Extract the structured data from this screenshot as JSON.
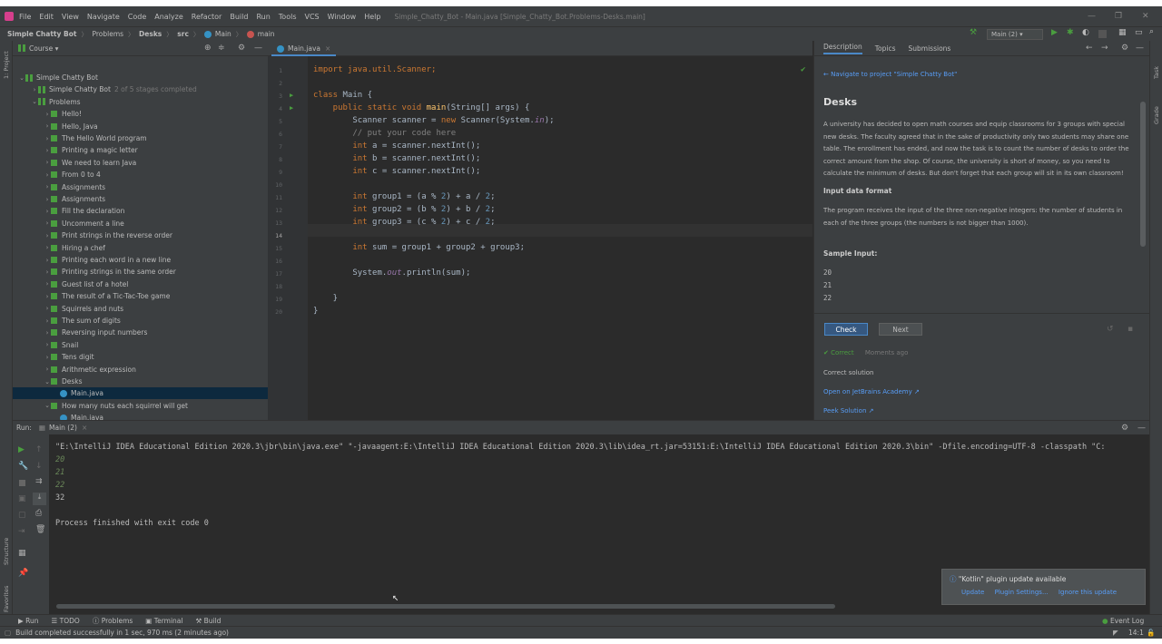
{
  "menubar": {
    "items": [
      "File",
      "Edit",
      "View",
      "Navigate",
      "Code",
      "Analyze",
      "Refactor",
      "Build",
      "Run",
      "Tools",
      "VCS",
      "Window",
      "Help"
    ],
    "window_title": "Simple_Chatty_Bot - Main.java [Simple_Chatty_Bot.Problems-Desks.main]"
  },
  "navbar": {
    "crumbs": [
      "Simple Chatty Bot",
      "Problems",
      "Desks",
      "src",
      "Main",
      "main"
    ],
    "run_config": "Main (2) ▾"
  },
  "project": {
    "header": "Course ▾",
    "side_label": "1: Project",
    "root": "Simple Chatty Bot",
    "stage_item": "Simple Chatty Bot",
    "stage_note": "2 of 5 stages completed",
    "problems_label": "Problems",
    "problems": [
      "Hello!",
      "Hello, Java",
      "The Hello World program",
      "Printing a magic letter",
      "We need to learn Java",
      "From 0 to 4",
      "Assignments",
      "Assignments",
      "Fill the declaration",
      "Uncomment a line",
      "Print strings in the reverse order",
      "Hiring a chef",
      "Printing each word in a new line",
      "Printing strings in the same order",
      "Guest list of a hotel",
      "The result of a Tic-Tac-Toe game",
      "Squirrels and nuts",
      "The sum of digits",
      "Reversing input numbers",
      "Snail",
      "Tens digit",
      "Arithmetic expression"
    ],
    "desks": "Desks",
    "desks_file": "Main.java",
    "nuts": "How many nuts each squirrel will get",
    "nuts_file": "Main.java"
  },
  "editor": {
    "tab": "Main.java",
    "line_numbers": [
      "1",
      "2",
      "3",
      "4",
      "5",
      "6",
      "7",
      "8",
      "9",
      "10",
      "11",
      "12",
      "13",
      "14",
      "15",
      "16",
      "17",
      "18",
      "19",
      "20"
    ],
    "lines": {
      "l1": "import java.util.Scanner;",
      "l3a": "class",
      "l3b": " Main {",
      "l4a": "    public static void ",
      "l4b": "main",
      "l4c": "(String[] args) {",
      "l5a": "        Scanner scanner = ",
      "l5b": "new",
      "l5c": " Scanner(System.",
      "l5d": "in",
      "l5e": ");",
      "l6": "        // put your code here",
      "l7a": "        int",
      "l7b": " a = scanner.nextInt();",
      "l8a": "        int",
      "l8b": " b = scanner.nextInt();",
      "l9a": "        int",
      "l9b": " c = scanner.nextInt();",
      "l11a": "        int",
      "l11b": " group1 = (a % ",
      "l11c": "2",
      "l11d": ") + a / ",
      "l11e": "2",
      "l11f": ";",
      "l12a": "        int",
      "l12b": " group2 = (b % ",
      "l12c": "2",
      "l12d": ") + b / ",
      "l12e": "2",
      "l12f": ";",
      "l13a": "        int",
      "l13b": " group3 = (c % ",
      "l13c": "2",
      "l13d": ") + c / ",
      "l13e": "2",
      "l13f": ";",
      "l15a": "        int",
      "l15b": " sum = group1 + group2 + group3;",
      "l17a": "        System.",
      "l17b": "out",
      "l17c": ".println(sum);",
      "l19": "    }",
      "l20": "}"
    }
  },
  "description": {
    "tabs": [
      "Description",
      "Topics",
      "Submissions"
    ],
    "nav_link": "Navigate to project \"Simple Chatty Bot\"",
    "title": "Desks",
    "body": "A university has decided to open math courses and equip classrooms for 3 groups with special new desks. The faculty agreed that in the sake of productivity only two students may share one table. The enrollment has ended, and now the task is to count the number of desks to order the correct amount from the shop. Of course, the university is short of money, so you need to calculate the minimum of desks. But don't forget that each group will sit in its own classroom!",
    "input_heading": "Input data format",
    "input_text": "The program receives the input of the three non-negative integers: the number of students in each of the three groups (the numbers is not bigger than 1000).",
    "sample_heading": "Sample Input:",
    "sample": [
      "20",
      "21",
      "22"
    ],
    "check": "Check",
    "next": "Next",
    "status": "Correct",
    "status_time": "Moments ago",
    "solution": "Correct solution",
    "open_link": "Open on JetBrains Academy ↗",
    "peek_link": "Peek Solution ↗",
    "side_label": "Task",
    "side_label2": "Grade"
  },
  "run": {
    "label": "Run:",
    "tab": "Main (2)",
    "cmd": "\"E:\\IntelliJ IDEA Educational Edition 2020.3\\jbr\\bin\\java.exe\" \"-javaagent:E:\\IntelliJ IDEA Educational Edition 2020.3\\lib\\idea_rt.jar=53151:E:\\IntelliJ IDEA Educational Edition 2020.3\\bin\" -Dfile.encoding=UTF-8 -classpath \"C:",
    "inputs": [
      "20",
      "21",
      "22"
    ],
    "output": "32",
    "exit": "Process finished with exit code 0"
  },
  "leftstrip": {
    "structure": "Structure",
    "favorites": "Favorites"
  },
  "toolwindows": [
    "Run",
    "TODO",
    "Problems",
    "Terminal",
    "Build"
  ],
  "event_log": "Event Log",
  "status": {
    "text": "Build completed successfully in 1 sec, 970 ms (2 minutes ago)",
    "position": "14:1"
  },
  "notification": {
    "title": "\"Kotlin\" plugin update available",
    "actions": [
      "Update",
      "Plugin Settings...",
      "Ignore this update"
    ]
  },
  "colors": {
    "accent": "#4a88c7",
    "green": "#4a9e3f",
    "link": "#589df6",
    "selection": "#0d293e"
  }
}
